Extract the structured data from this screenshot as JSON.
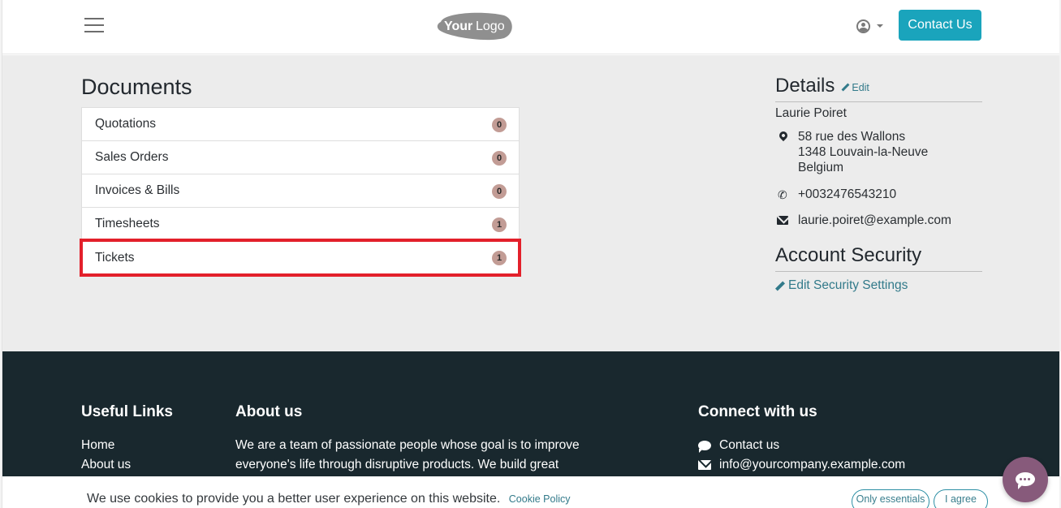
{
  "header": {
    "logo_text_bold": "Your",
    "logo_text_light": "Logo",
    "contact_button": "Contact Us"
  },
  "documents": {
    "title": "Documents",
    "items": [
      {
        "label": "Quotations",
        "count": "0"
      },
      {
        "label": "Sales Orders",
        "count": "0"
      },
      {
        "label": "Invoices & Bills",
        "count": "0"
      },
      {
        "label": "Timesheets",
        "count": "1"
      },
      {
        "label": "Tickets",
        "count": "1",
        "highlighted": true
      }
    ]
  },
  "details": {
    "title": "Details",
    "edit_label": "Edit",
    "name": "Laurie Poiret",
    "address": [
      "58 rue des Wallons",
      "1348 Louvain-la-Neuve",
      "Belgium"
    ],
    "phone": "+0032476543210",
    "email": "laurie.poiret@example.com"
  },
  "security": {
    "title": "Account Security",
    "link": "Edit Security Settings"
  },
  "footer": {
    "useful_links": {
      "title": "Useful Links",
      "links": [
        "Home",
        "About us"
      ]
    },
    "about": {
      "title": "About us",
      "text": "We are a team of passionate people whose goal is to improve everyone's life through disruptive products. We build great"
    },
    "connect": {
      "title": "Connect with us",
      "contact": "Contact us",
      "email": "info@yourcompany.example.com"
    }
  },
  "cookie": {
    "text": "We use cookies to provide you a better user experience on this website.",
    "policy_link": "Cookie Policy",
    "only_essentials": "Only essentials",
    "agree": "I agree"
  },
  "colors": {
    "accent": "#1aa4bc",
    "highlight": "#e3202b",
    "badge": "#c29c95",
    "footer_bg": "#19282e",
    "chat": "#875a7b"
  }
}
